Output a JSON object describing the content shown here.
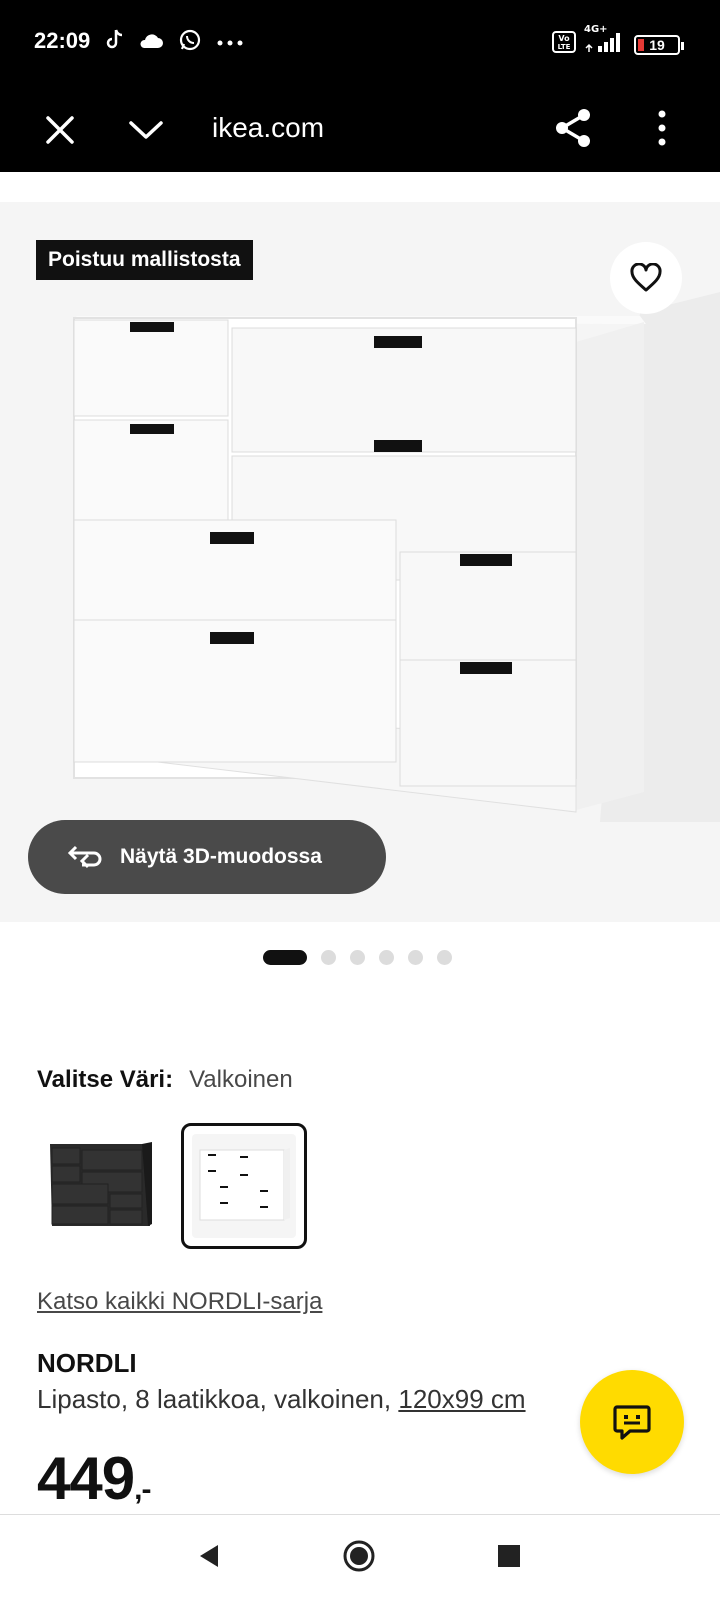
{
  "status_bar": {
    "time": "22:09",
    "network": "4G+",
    "battery": "19",
    "icons": [
      "tiktok-icon",
      "cloud-icon",
      "whatsapp-icon",
      "more-dots-icon",
      "volte-icon",
      "signal-icon",
      "battery-icon"
    ]
  },
  "browser": {
    "url": "ikea.com",
    "icons": [
      "close-icon",
      "chevron-down-icon",
      "share-icon",
      "more-vertical-icon"
    ]
  },
  "product_image": {
    "badge": "Poistuu mallistosta",
    "view3d_label": "Näytä 3D-muodossa",
    "carousel_total": 6,
    "carousel_active": 1
  },
  "color_select": {
    "label": "Valitse Väri:",
    "selected": "Valkoinen",
    "options": [
      "black",
      "white"
    ]
  },
  "series_link": "Katso kaikki NORDLI-sarja",
  "product": {
    "name": "NORDLI",
    "description": "Lipasto, 8 laatikkoa, valkoinen,",
    "size": "120x99 cm",
    "price": "449",
    "price_suffix": ",-"
  },
  "colors": {
    "chat_button": "#ffdb00",
    "badge_bg": "#111111",
    "view3d_bg": "#4a4a4a"
  }
}
